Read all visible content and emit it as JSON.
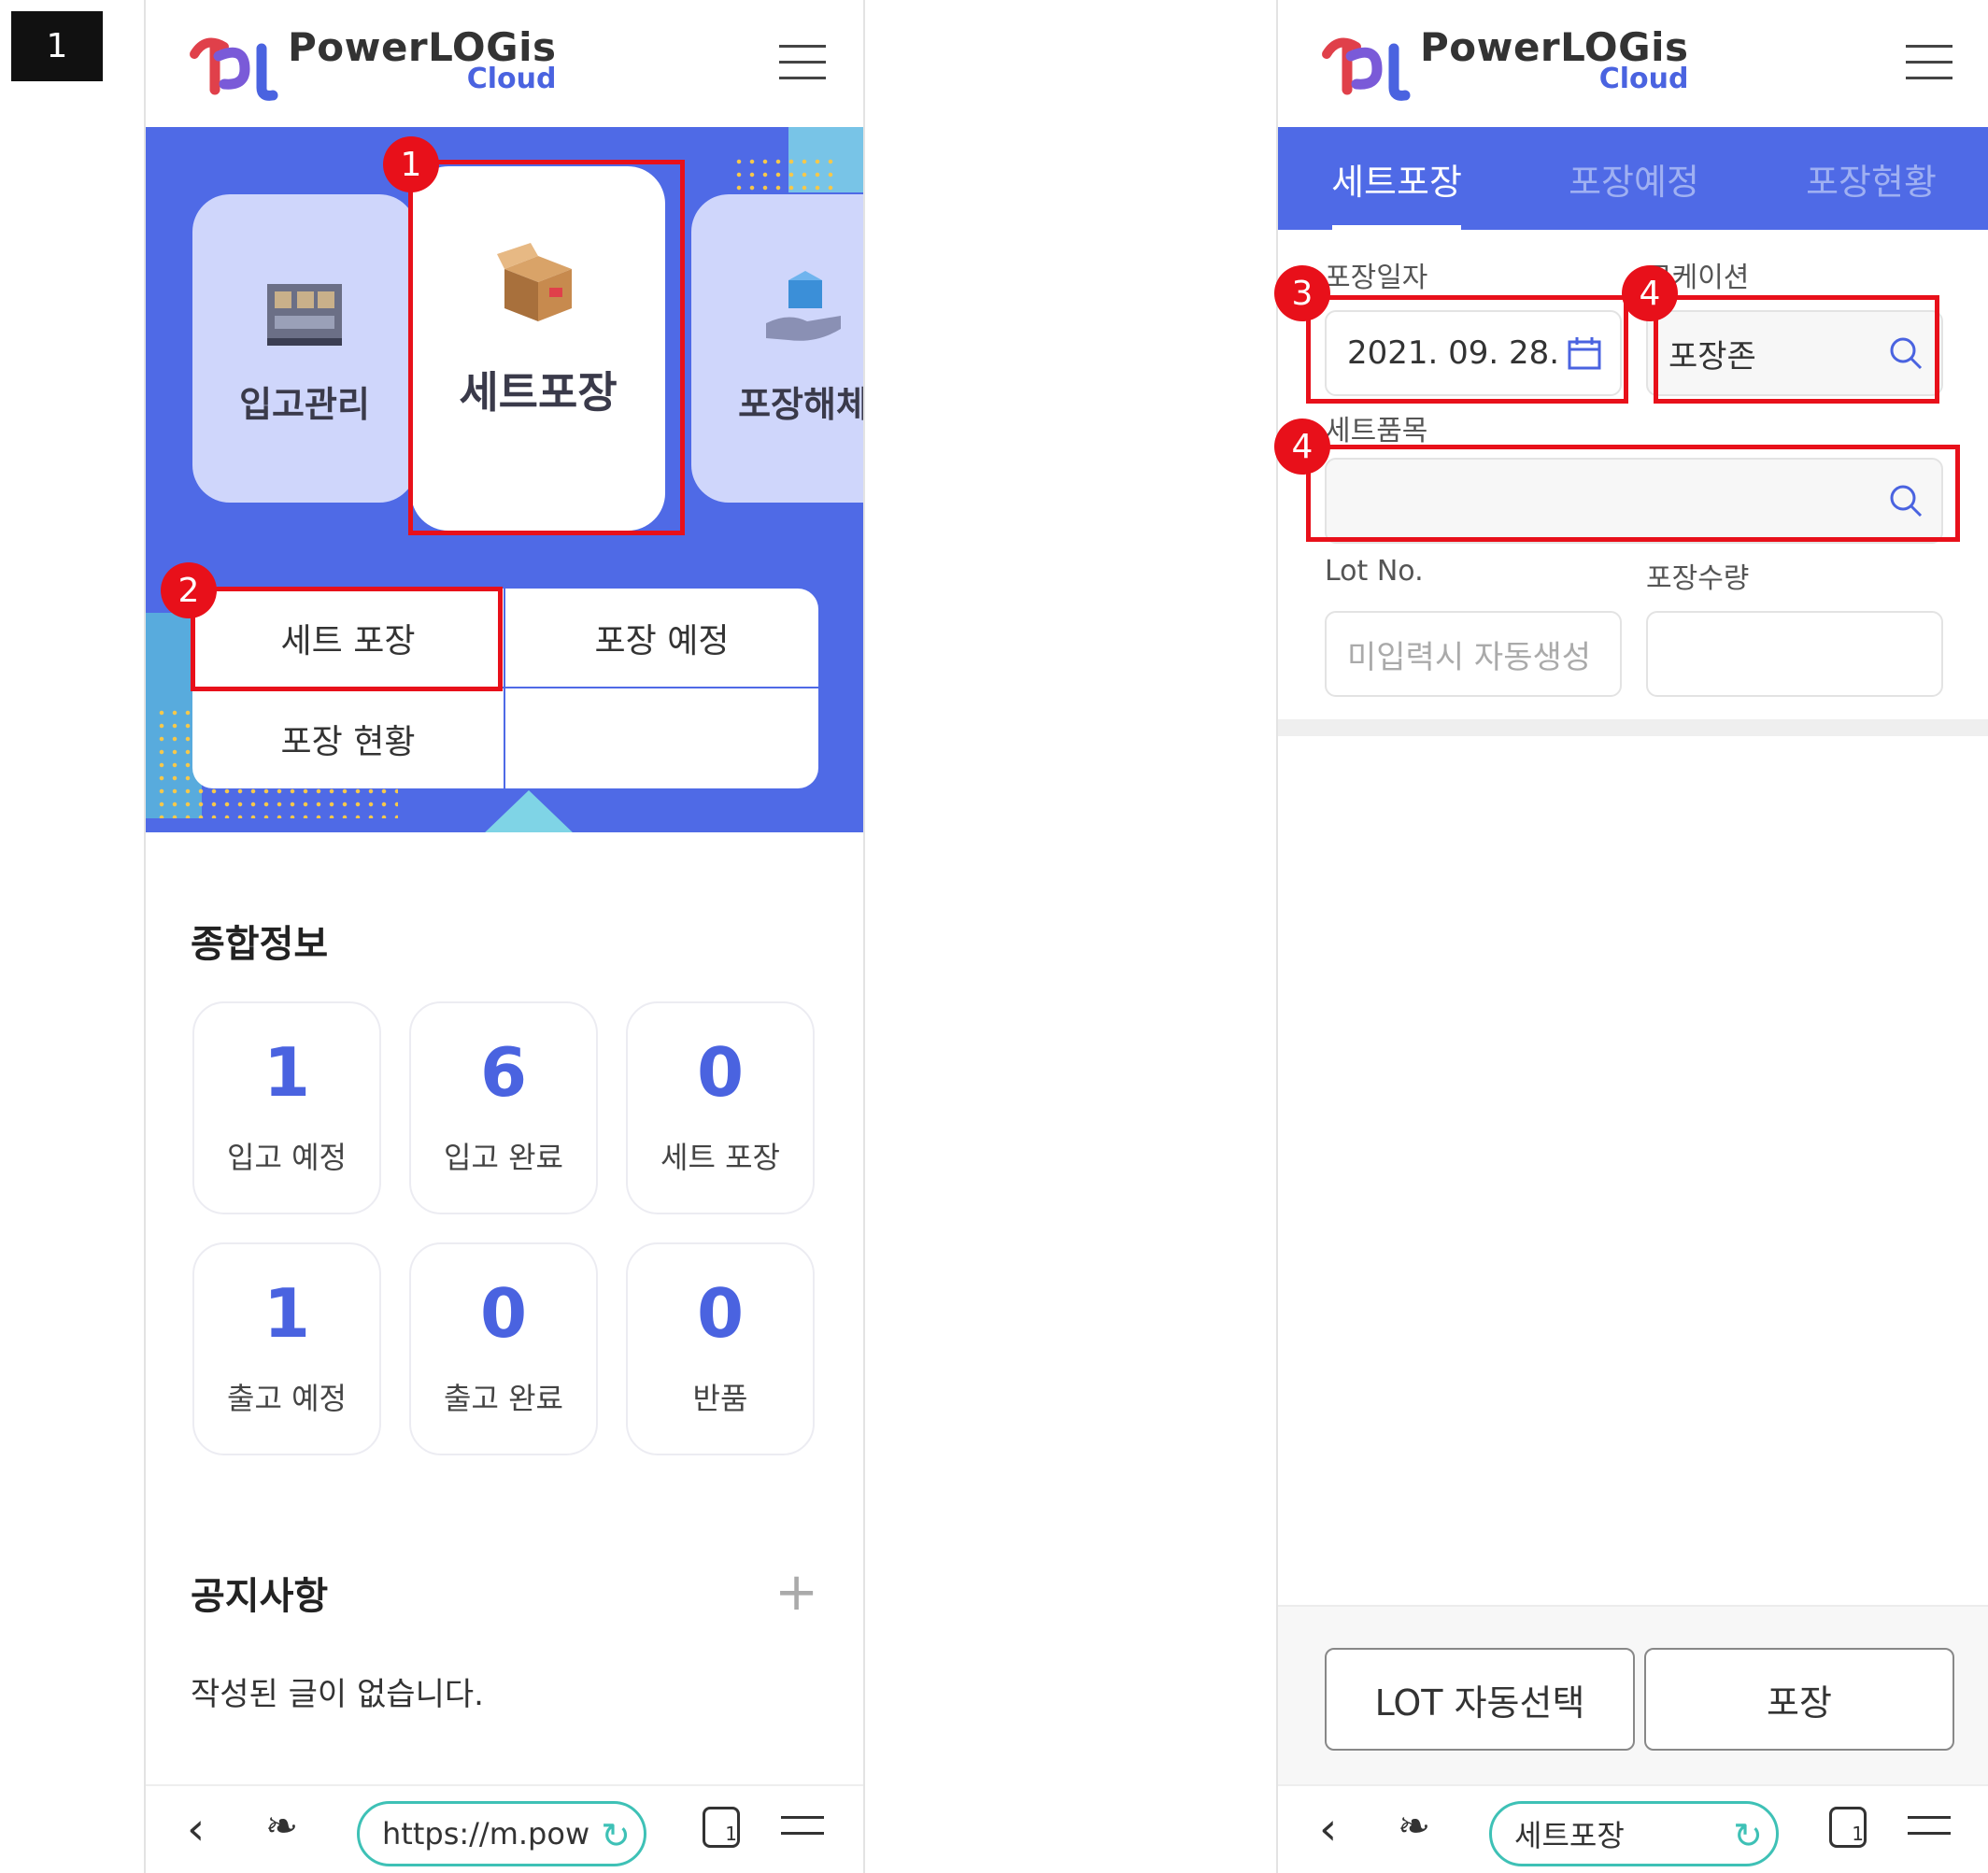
{
  "step_label": "1",
  "brand": {
    "title": "PowerLOGis",
    "sub": "Cloud"
  },
  "left": {
    "menu_cards": [
      "입고관리",
      "세트포장",
      "포장해체"
    ],
    "submenu": [
      "세트 포장",
      "포장 예정",
      "포장 현황"
    ],
    "summary_title": "종합정보",
    "stats": [
      {
        "value": "1",
        "label": "입고 예정"
      },
      {
        "value": "6",
        "label": "입고 완료"
      },
      {
        "value": "0",
        "label": "세트 포장"
      },
      {
        "value": "1",
        "label": "출고 예정"
      },
      {
        "value": "0",
        "label": "출고 완료"
      },
      {
        "value": "0",
        "label": "반품"
      }
    ],
    "notice_title": "공지사항",
    "notice_more": "+",
    "notice_empty": "작성된 글이 없습니다.",
    "browser_url": "https://m.pow"
  },
  "right": {
    "tabs": [
      "세트포장",
      "포장예정",
      "포장현황"
    ],
    "date_label": "포장일자",
    "date_value": "2021. 09. 28.",
    "location_label": "로케이션",
    "location_value": "포장존",
    "item_label": "세트품목",
    "item_value": "",
    "lot_label": "Lot No.",
    "lot_placeholder": "미입력시 자동생성",
    "qty_label": "포장수량",
    "qty_value": "",
    "btn_lot": "LOT 자동선택",
    "btn_pack": "포장",
    "browser_title": "세트포장"
  },
  "badges": [
    "1",
    "2",
    "3",
    "4",
    "4"
  ],
  "colors": {
    "primary": "#4f6ae6",
    "accent": "#4a63e0",
    "highlight": "#e8101a",
    "hero_card": "#cfd6fb"
  }
}
